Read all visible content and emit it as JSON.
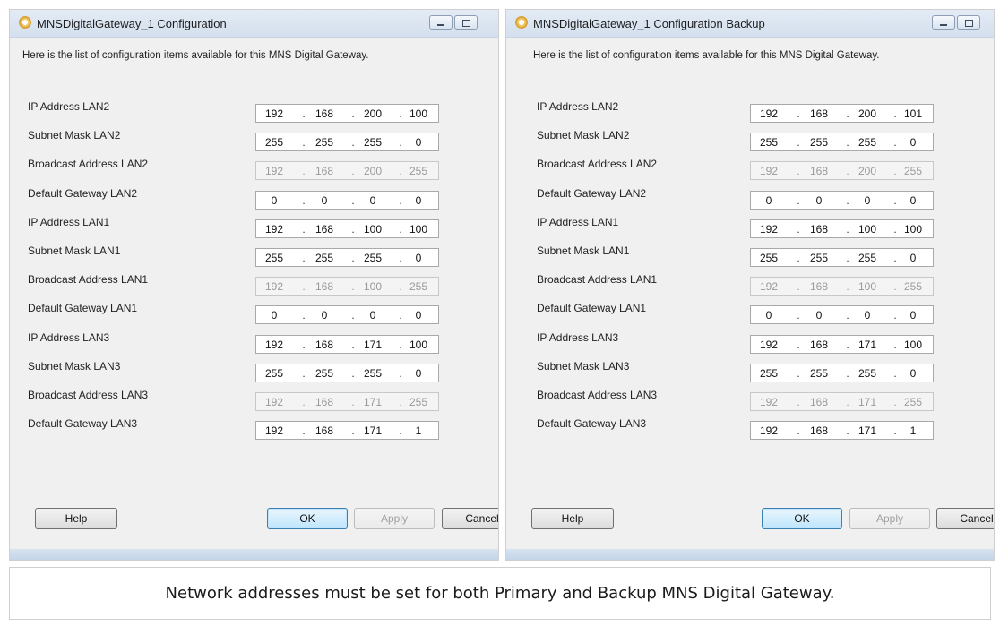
{
  "primary": {
    "title": "MNSDigitalGateway_1 Configuration",
    "intro": "Here is the list of configuration items available for this MNS Digital Gateway.",
    "rows": [
      {
        "label": "IP Address LAN2",
        "octets": [
          "192",
          "168",
          "200",
          "100"
        ],
        "disabled": false
      },
      {
        "label": "Subnet Mask LAN2",
        "octets": [
          "255",
          "255",
          "255",
          "0"
        ],
        "disabled": false
      },
      {
        "label": "Broadcast Address LAN2",
        "octets": [
          "192",
          "168",
          "200",
          "255"
        ],
        "disabled": true
      },
      {
        "label": "Default Gateway LAN2",
        "octets": [
          "0",
          "0",
          "0",
          "0"
        ],
        "disabled": false
      },
      {
        "label": "IP Address LAN1",
        "octets": [
          "192",
          "168",
          "100",
          "100"
        ],
        "disabled": false
      },
      {
        "label": "Subnet Mask LAN1",
        "octets": [
          "255",
          "255",
          "255",
          "0"
        ],
        "disabled": false
      },
      {
        "label": "Broadcast Address LAN1",
        "octets": [
          "192",
          "168",
          "100",
          "255"
        ],
        "disabled": true
      },
      {
        "label": "Default Gateway LAN1",
        "octets": [
          "0",
          "0",
          "0",
          "0"
        ],
        "disabled": false
      },
      {
        "label": "IP Address LAN3",
        "octets": [
          "192",
          "168",
          "171",
          "100"
        ],
        "disabled": false
      },
      {
        "label": "Subnet Mask LAN3",
        "octets": [
          "255",
          "255",
          "255",
          "0"
        ],
        "disabled": false
      },
      {
        "label": "Broadcast Address LAN3",
        "octets": [
          "192",
          "168",
          "171",
          "255"
        ],
        "disabled": true
      },
      {
        "label": "Default Gateway LAN3",
        "octets": [
          "192",
          "168",
          "171",
          "1"
        ],
        "disabled": false
      }
    ],
    "buttons": {
      "help": "Help",
      "ok": "OK",
      "apply": "Apply",
      "cancel": "Cancel"
    }
  },
  "backup": {
    "title": "MNSDigitalGateway_1 Configuration Backup",
    "intro": "Here is the list of configuration items available for this MNS Digital Gateway.",
    "rows": [
      {
        "label": "IP Address LAN2",
        "octets": [
          "192",
          "168",
          "200",
          "101"
        ],
        "disabled": false
      },
      {
        "label": "Subnet Mask LAN2",
        "octets": [
          "255",
          "255",
          "255",
          "0"
        ],
        "disabled": false
      },
      {
        "label": "Broadcast Address LAN2",
        "octets": [
          "192",
          "168",
          "200",
          "255"
        ],
        "disabled": true
      },
      {
        "label": "Default Gateway LAN2",
        "octets": [
          "0",
          "0",
          "0",
          "0"
        ],
        "disabled": false
      },
      {
        "label": "IP Address LAN1",
        "octets": [
          "192",
          "168",
          "100",
          "100"
        ],
        "disabled": false
      },
      {
        "label": "Subnet Mask LAN1",
        "octets": [
          "255",
          "255",
          "255",
          "0"
        ],
        "disabled": false
      },
      {
        "label": "Broadcast Address LAN1",
        "octets": [
          "192",
          "168",
          "100",
          "255"
        ],
        "disabled": true
      },
      {
        "label": "Default Gateway LAN1",
        "octets": [
          "0",
          "0",
          "0",
          "0"
        ],
        "disabled": false
      },
      {
        "label": "IP Address LAN3",
        "octets": [
          "192",
          "168",
          "171",
          "100"
        ],
        "disabled": false
      },
      {
        "label": "Subnet Mask LAN3",
        "octets": [
          "255",
          "255",
          "255",
          "0"
        ],
        "disabled": false
      },
      {
        "label": "Broadcast Address LAN3",
        "octets": [
          "192",
          "168",
          "171",
          "255"
        ],
        "disabled": true
      },
      {
        "label": "Default Gateway LAN3",
        "octets": [
          "192",
          "168",
          "171",
          "1"
        ],
        "disabled": false
      }
    ],
    "buttons": {
      "help": "Help",
      "ok": "OK",
      "apply": "Apply",
      "cancel": "Cancel"
    }
  },
  "caption": "Network addresses must be set for both Primary and Backup MNS Digital Gateway."
}
